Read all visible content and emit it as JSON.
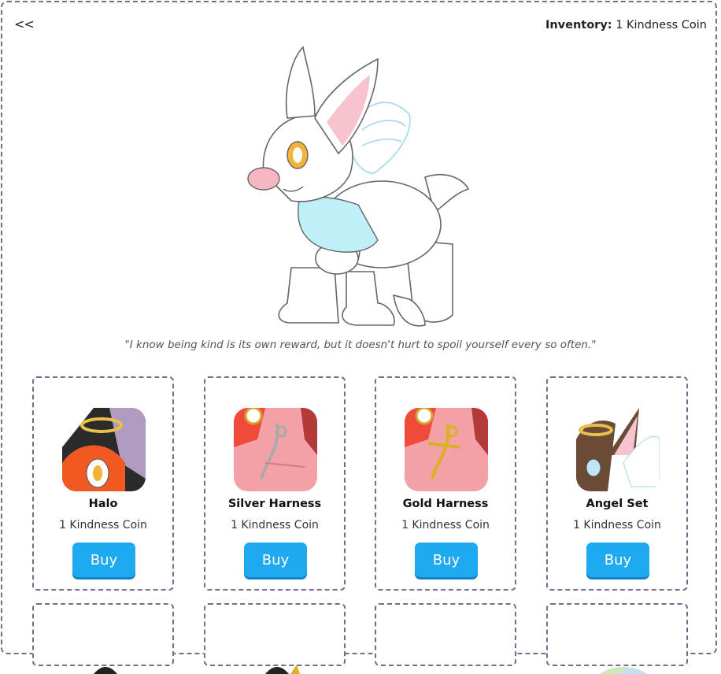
{
  "nav": {
    "back_label": "<<"
  },
  "inventory": {
    "label": "Inventory:",
    "value": "1 Kindness Coin"
  },
  "quote": "\"I know being kind is its own reward, but it doesn't hurt to spoil yourself every so often.\"",
  "items": [
    {
      "name": "Halo",
      "price": "1 Kindness Coin",
      "buy_label": "Buy"
    },
    {
      "name": "Silver Harness",
      "price": "1 Kindness Coin",
      "buy_label": "Buy"
    },
    {
      "name": "Gold Harness",
      "price": "1 Kindness Coin",
      "buy_label": "Buy"
    },
    {
      "name": "Angel Set",
      "price": "1 Kindness Coin",
      "buy_label": "Buy"
    }
  ],
  "colors": {
    "accent": "#1ea9f0",
    "border": "#7b6a8c"
  }
}
